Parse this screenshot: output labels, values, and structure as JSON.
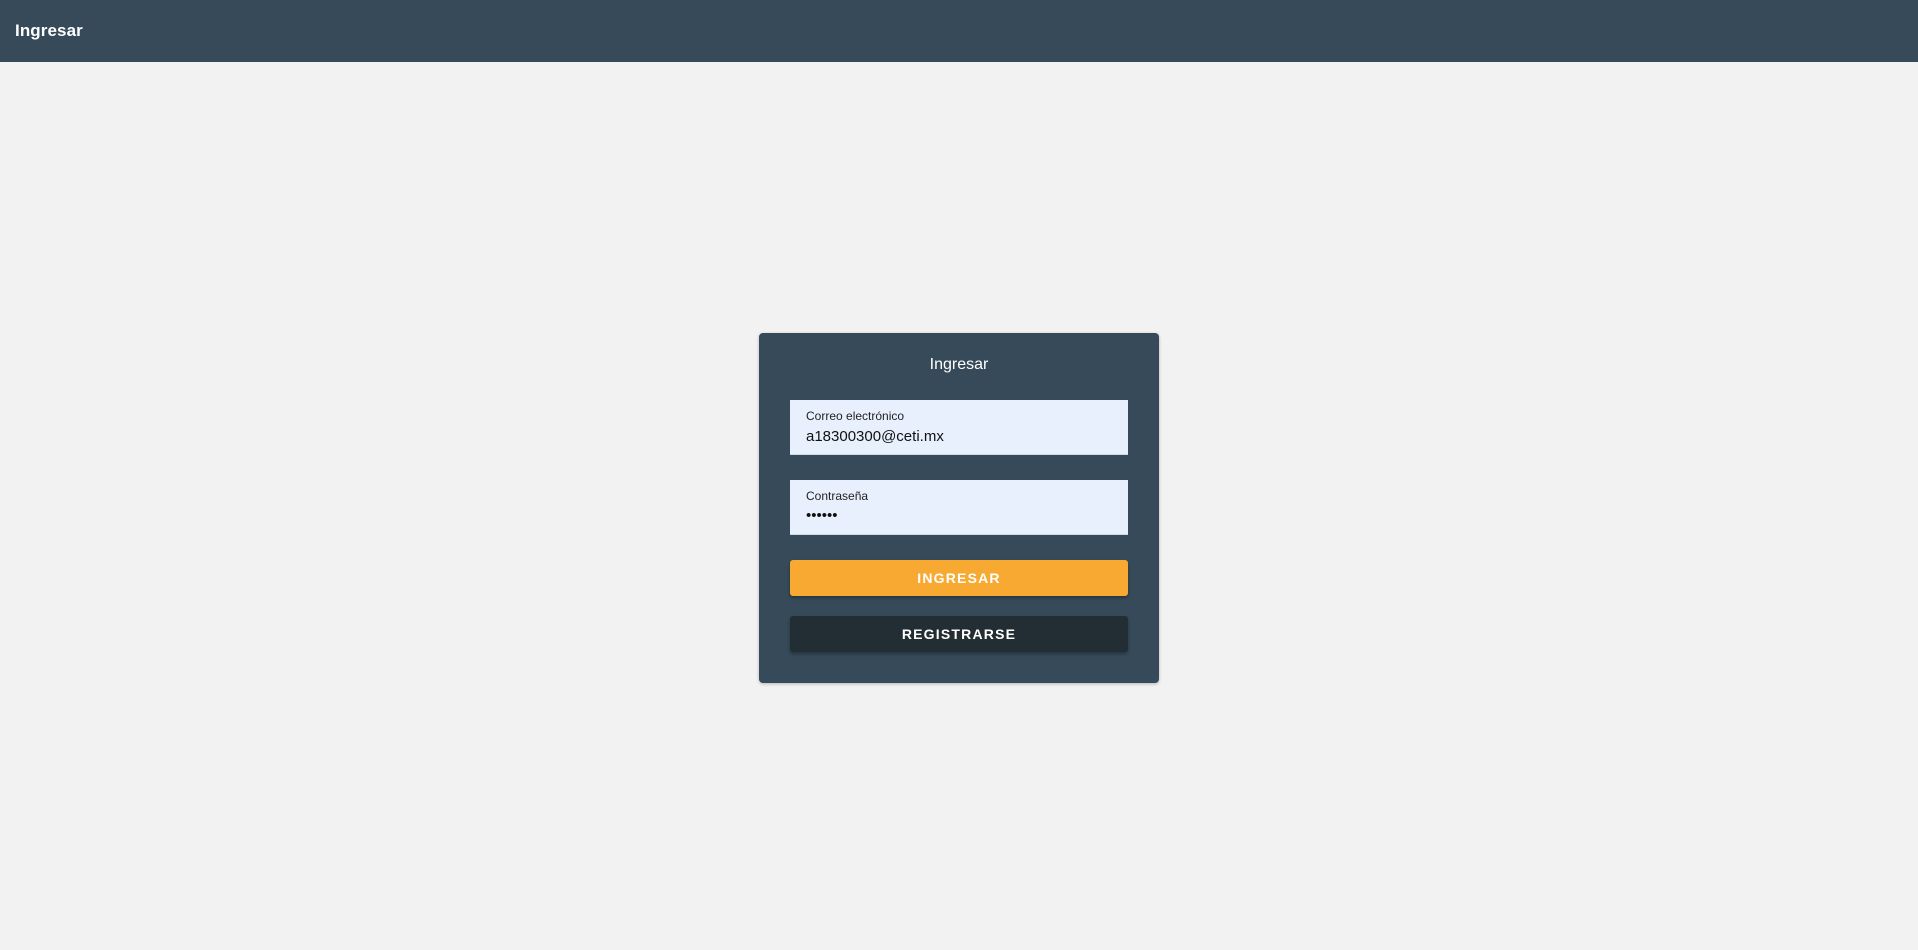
{
  "topbar": {
    "title": "Ingresar"
  },
  "login_card": {
    "title": "Ingresar",
    "email": {
      "label": "Correo electrónico",
      "value": "a18300300@ceti.mx"
    },
    "password": {
      "label": "Contraseña",
      "value": "••••••"
    },
    "login_button": "INGRESAR",
    "register_button": "REGISTRARSE"
  },
  "colors": {
    "header_bg": "#364a59",
    "page_bg": "#f2f2f2",
    "card_bg": "#364a59",
    "input_bg": "#e8f0fe",
    "login_button_bg": "#f8a932",
    "register_button_bg": "#222e33"
  }
}
